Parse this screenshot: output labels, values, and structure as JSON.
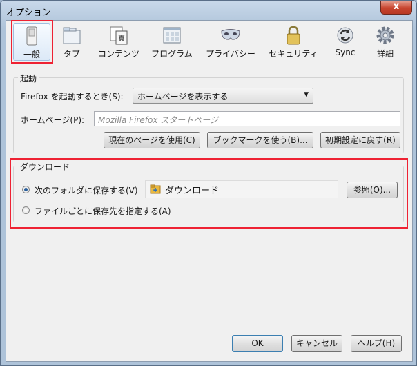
{
  "window": {
    "title": "オプション",
    "close_label": "x"
  },
  "toolbar": {
    "panes": [
      {
        "id": "general",
        "label": "一般",
        "icon": "general-switch-icon",
        "selected": true
      },
      {
        "id": "tabs",
        "label": "タブ",
        "icon": "tabs-window-icon"
      },
      {
        "id": "content",
        "label": "コンテンツ",
        "icon": "content-page-icon"
      },
      {
        "id": "applications",
        "label": "プログラム",
        "icon": "applications-window-icon"
      },
      {
        "id": "privacy",
        "label": "プライバシー",
        "icon": "privacy-mask-icon"
      },
      {
        "id": "security",
        "label": "セキュリティ",
        "icon": "security-lock-icon"
      },
      {
        "id": "sync",
        "label": "Sync",
        "icon": "sync-arrows-icon"
      },
      {
        "id": "advanced",
        "label": "詳細",
        "icon": "advanced-gear-icon"
      }
    ]
  },
  "startup": {
    "title": "起動",
    "when_starts_label": "Firefox を起動するとき(S):",
    "when_starts_value": "ホームページを表示する",
    "homepage_label": "ホームページ(P):",
    "homepage_placeholder": "Mozilla Firefox スタートページ",
    "use_current_label": "現在のページを使用(C)",
    "use_bookmark_label": "ブックマークを使う(B)...",
    "restore_default_label": "初期設定に戻す(R)"
  },
  "downloads": {
    "title": "ダウンロード",
    "save_to_label": "次のフォルダに保存する(V)",
    "save_to_checked": true,
    "folder_name": "ダウンロード",
    "browse_label": "参照(O)...",
    "always_ask_label": "ファイルごとに保存先を指定する(A)"
  },
  "footer": {
    "ok_label": "OK",
    "cancel_label": "キャンセル",
    "help_label": "ヘルプ(H)"
  },
  "colors": {
    "highlight": "#ee2233",
    "accent": "#2a5f9c"
  }
}
